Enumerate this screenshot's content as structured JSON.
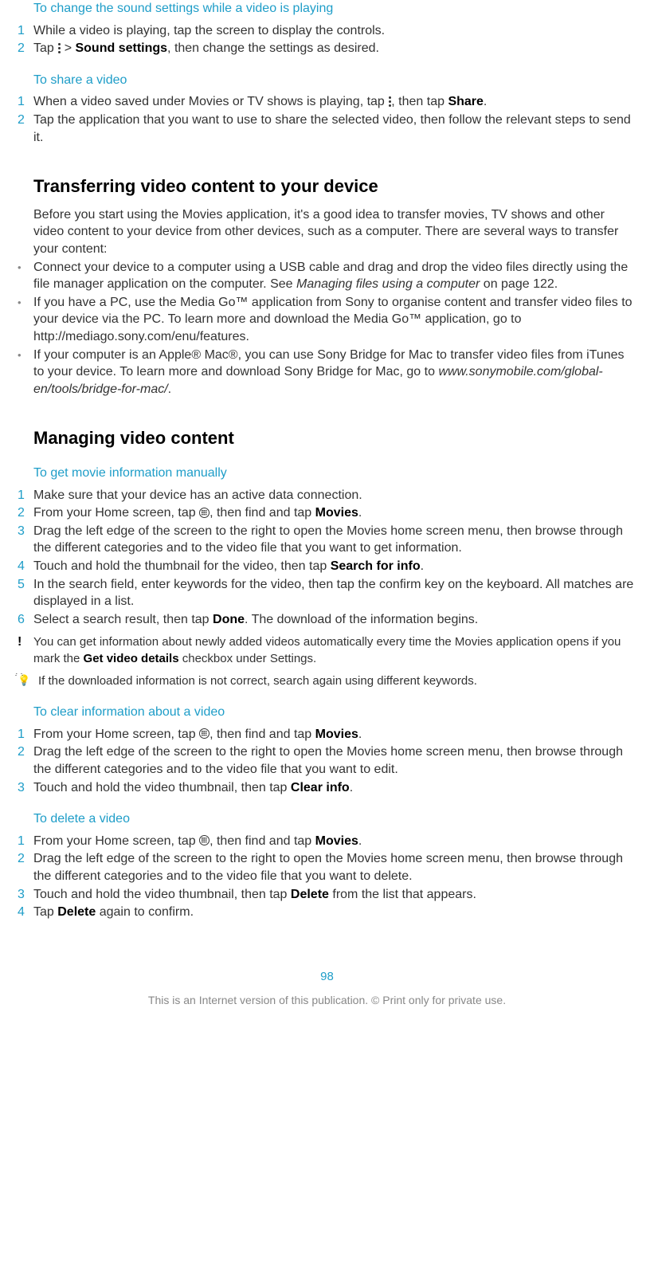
{
  "section1": {
    "heading": "To change the sound settings while a video is playing",
    "step1_num": "1",
    "step1": "While a video is playing, tap the screen to display the controls.",
    "step2_num": "2",
    "step2_a": "Tap ",
    "step2_b": " > ",
    "step2_bold": "Sound settings",
    "step2_c": ", then change the settings as desired."
  },
  "section2": {
    "heading": "To share a video",
    "step1_num": "1",
    "step1_a": "When a video saved under Movies or TV shows is playing, tap ",
    "step1_b": ", then tap ",
    "step1_bold": "Share",
    "step1_c": ".",
    "step2_num": "2",
    "step2": "Tap the application that you want to use to share the selected video, then follow the relevant steps to send it."
  },
  "section3": {
    "heading": "Transferring video content to your device",
    "intro": "Before you start using the Movies application, it's a good idea to transfer movies, TV shows and other video content to your device from other devices, such as a computer. There are several ways to transfer your content:",
    "bullet1_a": "Connect your device to a computer using a USB cable and drag and drop the video files directly using the file manager application on the computer. See ",
    "bullet1_italic": "Managing files using a computer",
    "bullet1_b": " on page 122.",
    "bullet2": "If you have a PC, use the Media Go™ application from Sony to organise content and transfer video files to your device via the PC. To learn more and download the Media Go™ application, go to http://mediago.sony.com/enu/features.",
    "bullet3_a": "If your computer is an Apple® Mac®, you can use Sony Bridge for Mac to transfer video files from iTunes to your device. To learn more and download Sony Bridge for Mac, go to ",
    "bullet3_italic": "www.sonymobile.com/global-en/tools/bridge-for-mac/",
    "bullet3_b": "."
  },
  "section4": {
    "heading": "Managing video content",
    "sub1": "To get movie information manually",
    "s1": {
      "n1": "1",
      "t1": "Make sure that your device has an active data connection.",
      "n2": "2",
      "t2a": "From your Home screen, tap ",
      "t2b": ", then find and tap ",
      "t2bold": "Movies",
      "t2c": ".",
      "n3": "3",
      "t3": "Drag the left edge of the screen to the right to open the Movies home screen menu, then browse through the different categories and to the video file that you want to get information.",
      "n4": "4",
      "t4a": "Touch and hold the thumbnail for the video, then tap ",
      "t4bold": "Search for info",
      "t4b": ".",
      "n5": "5",
      "t5": "In the search field, enter keywords for the video, then tap the confirm key on the keyboard. All matches are displayed in a list.",
      "n6": "6",
      "t6a": "Select a search result, then tap ",
      "t6bold": "Done",
      "t6b": ". The download of the information begins."
    },
    "note1a": "You can get information about newly added videos automatically every time the Movies application opens if you mark the ",
    "note1bold": "Get video details",
    "note1b": " checkbox under Settings.",
    "tip1": "If the downloaded information is not correct, search again using different keywords.",
    "sub2": "To clear information about a video",
    "s2": {
      "n1": "1",
      "t1a": "From your Home screen, tap ",
      "t1b": ", then find and tap ",
      "t1bold": "Movies",
      "t1c": ".",
      "n2": "2",
      "t2": "Drag the left edge of the screen to the right to open the Movies home screen menu, then browse through the different categories and to the video file that you want to edit.",
      "n3": "3",
      "t3a": "Touch and hold the video thumbnail, then tap ",
      "t3bold": "Clear info",
      "t3b": "."
    },
    "sub3": "To delete a video",
    "s3": {
      "n1": "1",
      "t1a": "From your Home screen, tap ",
      "t1b": ", then find and tap ",
      "t1bold": "Movies",
      "t1c": ".",
      "n2": "2",
      "t2": "Drag the left edge of the screen to the right to open the Movies home screen menu, then browse through the different categories and to the video file that you want to delete.",
      "n3": "3",
      "t3a": "Touch and hold the video thumbnail, then tap ",
      "t3bold": "Delete",
      "t3b": " from the list that appears.",
      "n4": "4",
      "t4a": "Tap ",
      "t4bold": "Delete",
      "t4b": " again to confirm."
    }
  },
  "pagenum": "98",
  "footer": "This is an Internet version of this publication. © Print only for private use."
}
